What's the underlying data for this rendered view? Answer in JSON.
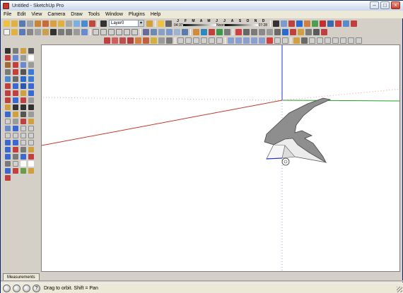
{
  "window": {
    "title": "Untitled - SketchUp Pro"
  },
  "menu": [
    "File",
    "Edit",
    "View",
    "Camera",
    "Draw",
    "Tools",
    "Window",
    "Plugins",
    "Help"
  ],
  "toolbar": {
    "layer_value": "Layer0",
    "shadow_months": [
      "J",
      "F",
      "M",
      "A",
      "M",
      "J",
      "J",
      "A",
      "S",
      "O",
      "N",
      "D"
    ],
    "shadow_time_left": "04:37",
    "shadow_time_mid": "Noon",
    "shadow_time_right": "07:28"
  },
  "measurements": {
    "label": "Measurements"
  },
  "status": {
    "hint": "Drag to orbit.  Shift = Pan"
  },
  "colors": {
    "red_axis": "#d11b1b",
    "green_axis": "#20a020",
    "blue_axis": "#1f2fd0",
    "model_top": "#8e8e8e",
    "model_front": "#ececec",
    "accent": "#0a246a"
  },
  "icons": {
    "titlebar": "sketchup-icon",
    "status": [
      "geo-location-icon",
      "credits-icon",
      "user-icon",
      "help-icon"
    ]
  }
}
